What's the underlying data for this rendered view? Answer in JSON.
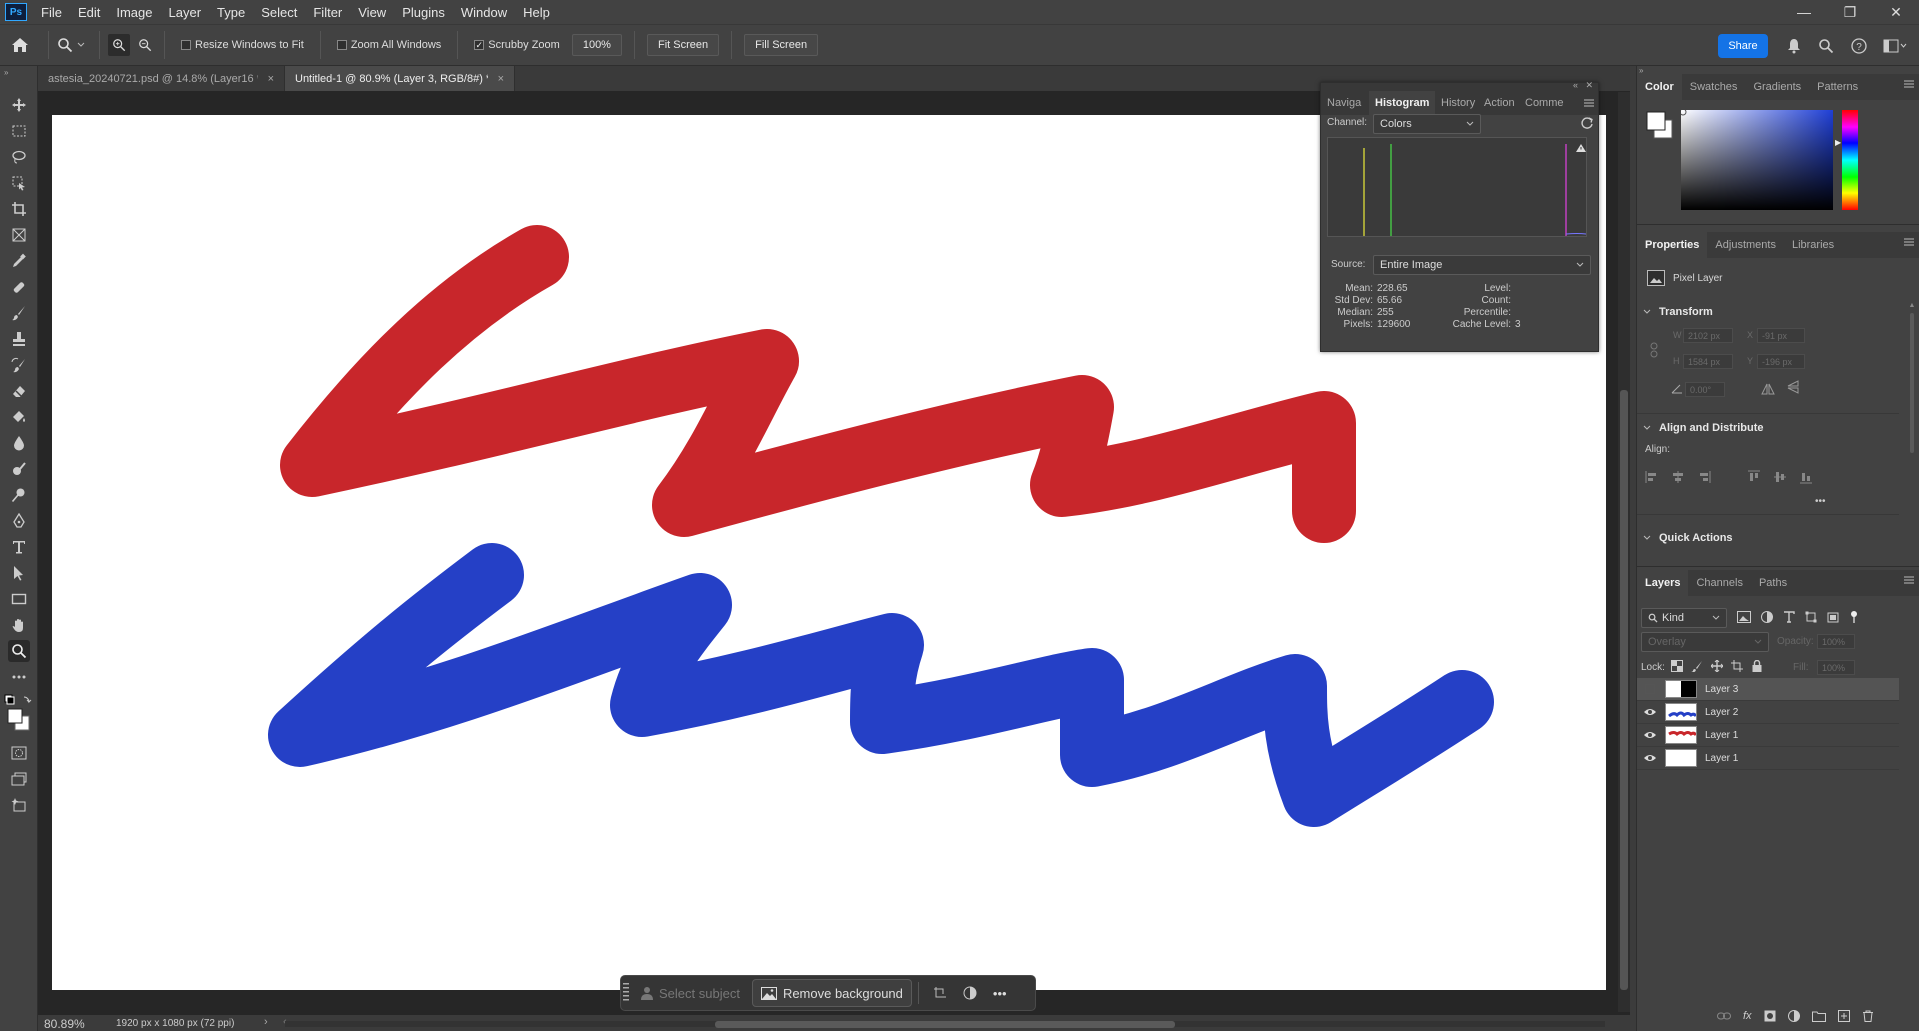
{
  "app": {
    "logo": "Ps"
  },
  "menu": [
    "File",
    "Edit",
    "Image",
    "Layer",
    "Type",
    "Select",
    "Filter",
    "View",
    "Plugins",
    "Window",
    "Help"
  ],
  "window_controls": {
    "minimize": "—",
    "restore": "❐",
    "close": "✕"
  },
  "options": {
    "resize_windows": "Resize Windows to Fit",
    "zoom_all": "Zoom All Windows",
    "scrubby_zoom": "Scrubby Zoom",
    "scrubby_checked": "✓",
    "zoom_value": "100%",
    "fit_screen": "Fit Screen",
    "fill_screen": "Fill Screen",
    "share": "Share"
  },
  "tabs": [
    {
      "label": "astesia_20240721.psd @ 14.8% (Layer16 *",
      "close": "×"
    },
    {
      "label": "Untitled-1 @ 80.9% (Layer 3, RGB/8#) *",
      "close": "×"
    }
  ],
  "histogram": {
    "tabs": [
      "Naviga",
      "Histogram",
      "History",
      "Action",
      "Comme"
    ],
    "channel_label": "Channel:",
    "channel_value": "Colors",
    "source_label": "Source:",
    "source_value": "Entire Image",
    "stats": {
      "mean_label": "Mean:",
      "mean": "228.65",
      "stddev_label": "Std Dev:",
      "stddev": "65.66",
      "median_label": "Median:",
      "median": "255",
      "pixels_label": "Pixels:",
      "pixels": "129600",
      "level_label": "Level:",
      "level": "",
      "count_label": "Count:",
      "count": "",
      "percentile_label": "Percentile:",
      "percentile": "",
      "cache_label": "Cache Level:",
      "cache": "3"
    }
  },
  "color_panel": {
    "tabs": [
      "Color",
      "Swatches",
      "Gradients",
      "Patterns"
    ],
    "picker_color": "#1f3fd6"
  },
  "properties": {
    "tabs": [
      "Properties",
      "Adjustments",
      "Libraries"
    ],
    "layer_type": "Pixel Layer",
    "transform": "Transform",
    "w_label": "W",
    "w": "2102 px",
    "h_label": "H",
    "h": "1584 px",
    "x_label": "X",
    "x": "-91 px",
    "y_label": "Y",
    "y": "-196 px",
    "angle": "0.00°",
    "align_distribute": "Align and Distribute",
    "align_label": "Align:",
    "more": "•••",
    "quick_actions": "Quick Actions"
  },
  "layers_panel": {
    "tabs": [
      "Layers",
      "Channels",
      "Paths"
    ],
    "kind": "Kind",
    "blend_mode": "Overlay",
    "opacity_label": "Opacity:",
    "opacity": "100%",
    "lock_label": "Lock:",
    "fill_label": "Fill:",
    "fill": "100%",
    "layers": [
      {
        "name": "Layer 3",
        "visible": false,
        "selected": true
      },
      {
        "name": "Layer 2",
        "visible": true,
        "selected": false
      },
      {
        "name": "Layer 1",
        "visible": true,
        "selected": false
      },
      {
        "name": "Layer 1",
        "visible": true,
        "selected": false
      }
    ]
  },
  "taskbar": {
    "select_subject": "Select subject",
    "remove_background": "Remove background",
    "more": "•••"
  },
  "status": {
    "zoom": "80.89%",
    "doc_info": "1920 px x 1080 px (72 ppi)"
  },
  "stroke_colors": {
    "red": "#c8262b",
    "blue": "#2540c6"
  }
}
